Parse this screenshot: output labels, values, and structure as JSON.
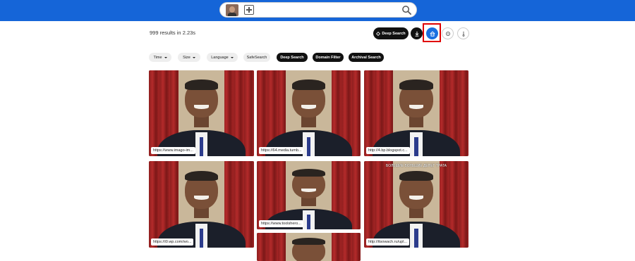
{
  "search": {
    "placeholder": ""
  },
  "results": {
    "summary": "999 results in 2.23s"
  },
  "toolbar": {
    "deep_search_label": "Deep Search"
  },
  "filters": [
    {
      "label": "Time",
      "dropdown": true,
      "style": "light"
    },
    {
      "label": "Size",
      "dropdown": true,
      "style": "light"
    },
    {
      "label": "Language",
      "dropdown": true,
      "style": "light"
    },
    {
      "label": "SafeSearch",
      "dropdown": false,
      "style": "light"
    },
    {
      "label": "Deep Search",
      "dropdown": false,
      "style": "dark"
    },
    {
      "label": "Domain Filter",
      "dropdown": false,
      "style": "dark"
    },
    {
      "label": "Archival Search",
      "dropdown": false,
      "style": "dark"
    }
  ],
  "images": [
    {
      "url": "https://www.imago-im..."
    },
    {
      "url": "https://64.media.tumb..."
    },
    {
      "url": "http://4.bp.blogspot.c..."
    },
    {
      "url": "https://i0.wp.com/wo..."
    },
    {
      "url": "https://www.toolshero..."
    },
    {
      "url": "http://itsowach.ru/upl...",
      "caption": "БОЛЬШИЕ БОЛЬШИЕ ДЕНЕГ ТРАТА"
    },
    {
      "url": ""
    }
  ],
  "colors": {
    "topbar": "#1565d8",
    "accent": "#1a6fe0",
    "highlight": "#e00000"
  }
}
